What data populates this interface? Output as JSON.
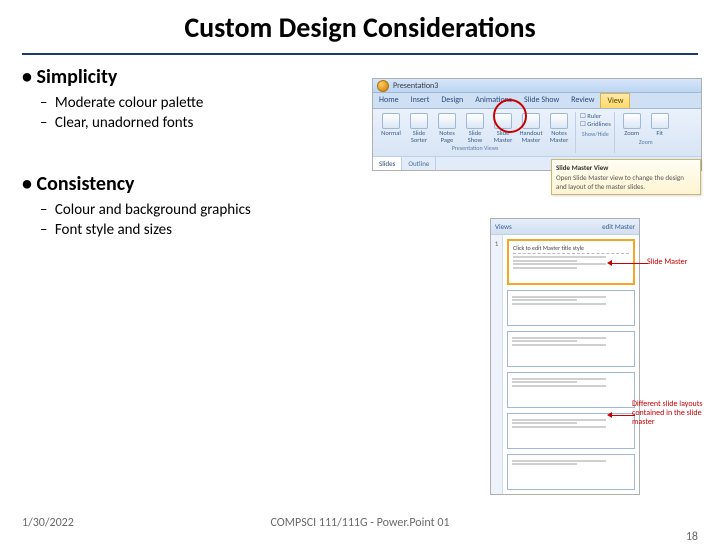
{
  "title": "Custom Design Considerations",
  "bullets": [
    {
      "heading": "Simplicity",
      "subs": [
        "Moderate colour palette",
        "Clear, unadorned fonts"
      ]
    },
    {
      "heading": "Consistency",
      "subs": [
        "Colour and background graphics",
        "Font style and sizes"
      ]
    }
  ],
  "footer": {
    "date": "1/30/2022",
    "center": "COMPSCI 111/111G - Power.Point 01",
    "page": "18"
  },
  "ribbon": {
    "window_title": "Presentation3",
    "tabs": [
      "Home",
      "Insert",
      "Design",
      "Animations",
      "Slide Show",
      "Review",
      "View"
    ],
    "active_tab": "View",
    "groups": {
      "presentation_views": {
        "label": "Presentation Views",
        "items": [
          "Normal",
          "Slide Sorter",
          "Notes Page",
          "Slide Show",
          "Slide Master",
          "Handout Master",
          "Notes Master"
        ]
      },
      "show_hide": {
        "label": "Show/Hide",
        "items": [
          "Ruler",
          "Gridlines"
        ]
      },
      "zoom": {
        "label": "Zoom",
        "items": [
          "Zoom",
          "Fit"
        ]
      }
    },
    "strip_tabs": [
      "Slides",
      "Outline"
    ],
    "tooltip": {
      "title": "Slide Master View",
      "body": "Open Slide Master view to change the design and layout of the master slides."
    }
  },
  "smpanel": {
    "header_left": "Views",
    "header_right": "edit Master",
    "master_title": "Click to edit Master title style",
    "num": "1"
  },
  "callouts": {
    "c1": "Slide Master",
    "c2": "Different slide layouts contained in the slide master"
  }
}
